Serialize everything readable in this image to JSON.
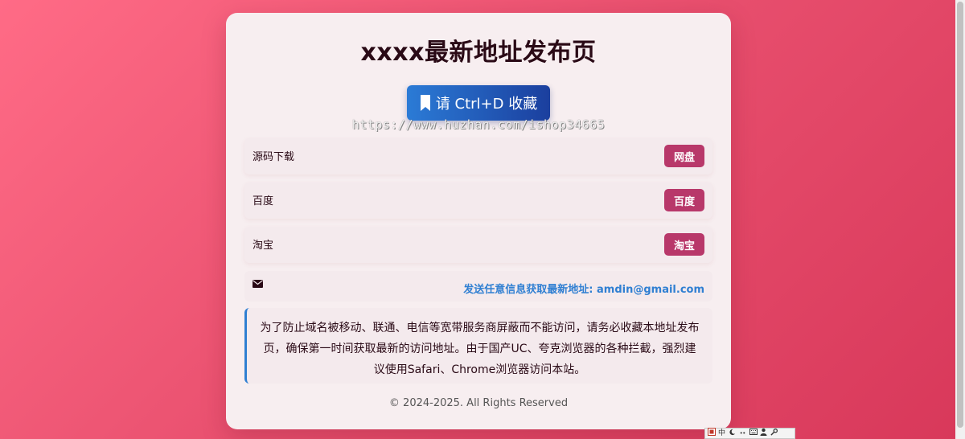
{
  "page": {
    "title": "xxxx最新地址发布页",
    "bookmark_label": "请 Ctrl+D 收藏",
    "watermark": "https://www.huzhan.com/ishop34665"
  },
  "links": [
    {
      "label": "源码下载",
      "button": "网盘"
    },
    {
      "label": "百度",
      "button": "百度"
    },
    {
      "label": "淘宝",
      "button": "淘宝"
    }
  ],
  "contact": {
    "text": "发送任意信息获取最新地址: amdin@gmail.com"
  },
  "notice": {
    "text": "为了防止域名被移动、联通、电信等宽带服务商屏蔽而不能访问，请务必收藏本地址发布页，确保第一时间获取最新的访问地址。由于国产UC、夸克浏览器的各种拦截，强烈建议使用Safari、Chrome浏览器访问本站。"
  },
  "footer": {
    "copyright": "© 2024-2025. All Rights Reserved"
  },
  "ime": {
    "mode": "中",
    "icons": [
      "ime-logo-icon",
      "moon-icon",
      "punctuation-icon",
      "keyboard-icon",
      "user-icon",
      "wrench-icon"
    ]
  },
  "colors": {
    "background_start": "#ff6b86",
    "background_end": "#d8385a",
    "card": "#f7eef0",
    "bookmark_start": "#2b7bd6",
    "bookmark_end": "#1b3f9e",
    "link_button": "#b8386a",
    "contact_text": "#2f7fd2"
  }
}
